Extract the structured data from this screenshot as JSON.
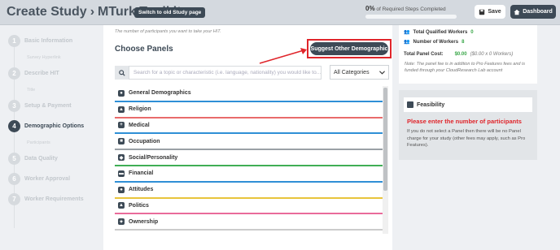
{
  "header": {
    "title": "Create Study",
    "chevron": "›",
    "subtitle": "MTurk Toolkit",
    "old_page_button": "Switch to old Study page",
    "progress_percent": "0%",
    "progress_label": "of Required Steps Completed",
    "progress_value": 0,
    "save_label": "Save",
    "dashboard_label": "Dashboard"
  },
  "sidebar": {
    "steps": [
      {
        "num": "1",
        "label": "Basic Information",
        "sub": "Survey Hyperlink"
      },
      {
        "num": "2",
        "label": "Describe HIT",
        "sub": "Title"
      },
      {
        "num": "3",
        "label": "Setup & Payment",
        "sub": ""
      },
      {
        "num": "4",
        "label": "Demographic Options",
        "sub": "Participants",
        "active": true
      },
      {
        "num": "5",
        "label": "Data Quality",
        "sub": ""
      },
      {
        "num": "6",
        "label": "Worker Approval",
        "sub": ""
      },
      {
        "num": "7",
        "label": "Worker Requirements",
        "sub": ""
      }
    ]
  },
  "main": {
    "hint": "The number of participants you want to take your HIT.",
    "choose_title": "Choose Panels",
    "suggest_button": "Suggest Other Demographic",
    "search_placeholder": "Search for a topic or characteristic (i.e. language, nationality) you would like to...",
    "category_select": "All Categories",
    "panels": [
      {
        "label": "General Demographics",
        "icon": "person-icon",
        "color": "#2f8fd6"
      },
      {
        "label": "Religion",
        "icon": "building-icon",
        "color": "#e96b6b"
      },
      {
        "label": "Medical",
        "icon": "medical-icon",
        "color": "#2f8fd6"
      },
      {
        "label": "Occupation",
        "icon": "briefcase-icon",
        "color": "#9aa0a6"
      },
      {
        "label": "Social/Personality",
        "icon": "social-icon",
        "color": "#3fae55"
      },
      {
        "label": "Financial",
        "icon": "money-icon",
        "color": "#2f8fd6"
      },
      {
        "label": "Attitudes",
        "icon": "attitude-icon",
        "color": "#e8c43c"
      },
      {
        "label": "Politics",
        "icon": "politics-icon",
        "color": "#e96b9b"
      },
      {
        "label": "Ownership",
        "icon": "ownership-icon",
        "color": "#cccccc"
      }
    ]
  },
  "cost": {
    "total_qualified_label": "Total Qualified Workers",
    "total_qualified_value": "0",
    "workers_label": "Number of Workers",
    "workers_value": "8",
    "panel_cost_label": "Total Panel Cost:",
    "panel_cost_value": "$0.00",
    "panel_cost_detail": "($0.00 x 0 Workers)",
    "note": "Note: The panel fee is in addition to Pro Features fees and is funded through your CloudResearch Lab account"
  },
  "feasibility": {
    "title": "Feasibility",
    "warning": "Please enter the number of participants",
    "text": "If you do not select a Panel then there will be no Panel charge for your study (other fees may apply, such as Pro Features)."
  },
  "colors": {
    "accent_dark": "#3d4a56",
    "highlight_red": "#e0252b",
    "green": "#39a748"
  }
}
